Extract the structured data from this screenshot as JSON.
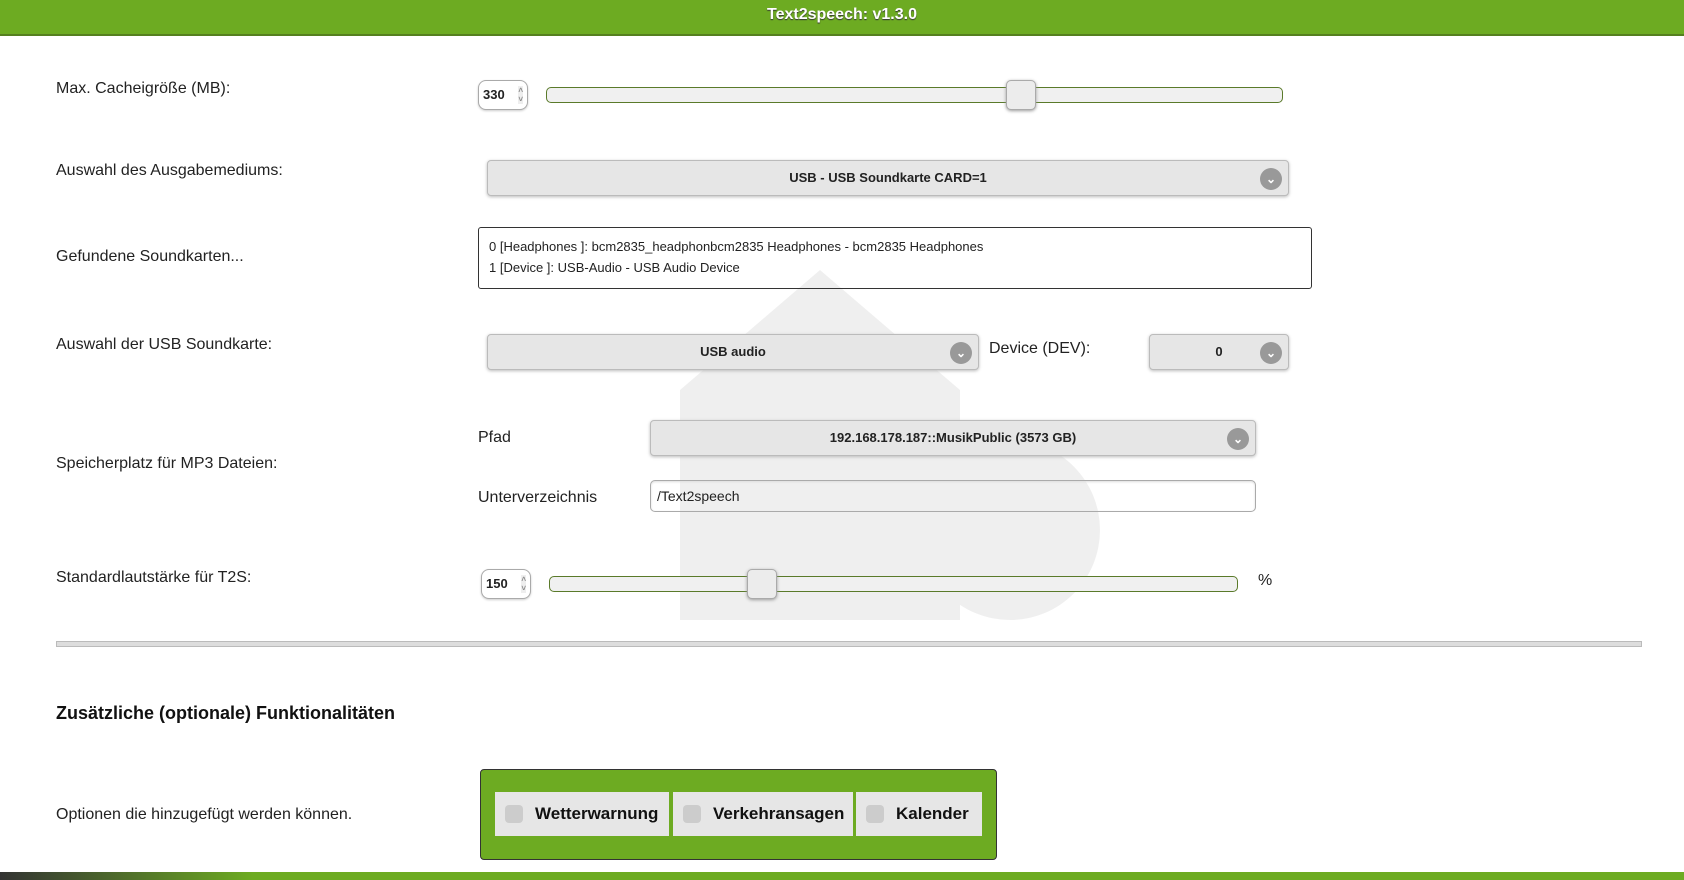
{
  "header": {
    "title": "Text2speech: v1.3.0"
  },
  "cache": {
    "label": "Max. Cacheigröße (MB):",
    "value": "330",
    "slider_fraction": 0.65
  },
  "output": {
    "label": "Auswahl des Ausgabemediums:",
    "selected": "USB - USB Soundkarte CARD=1"
  },
  "soundcards": {
    "label": "Gefundene Soundkarten...",
    "lines": [
      "0 [Headphones ]: bcm2835_headphonbcm2835 Headphones - bcm2835 Headphones",
      "1 [Device ]: USB-Audio - USB Audio Device"
    ]
  },
  "usb": {
    "label": "Auswahl der USB Soundkarte:",
    "selected": "USB audio",
    "device_label": "Device (DEV):",
    "device_selected": "0"
  },
  "storage": {
    "label": "Speicherplatz für MP3 Dateien:",
    "path_label": "Pfad",
    "path_selected": "192.168.178.187::MusikPublic (3573 GB)",
    "subdir_label": "Unterverzeichnis",
    "subdir_value": "/Text2speech"
  },
  "volume": {
    "label": "Standardlautstärke für T2S:",
    "value": "150",
    "unit": "%",
    "slider_fraction": 0.3
  },
  "extras": {
    "heading": "Zusätzliche (optionale) Funktionalitäten",
    "label": "Optionen die hinzugefügt werden können.",
    "options": [
      {
        "label": "Wetterwarnung",
        "checked": false
      },
      {
        "label": "Verkehransagen",
        "checked": false
      },
      {
        "label": "Kalender",
        "checked": false
      }
    ]
  },
  "colors": {
    "accent": "#6dab22"
  }
}
